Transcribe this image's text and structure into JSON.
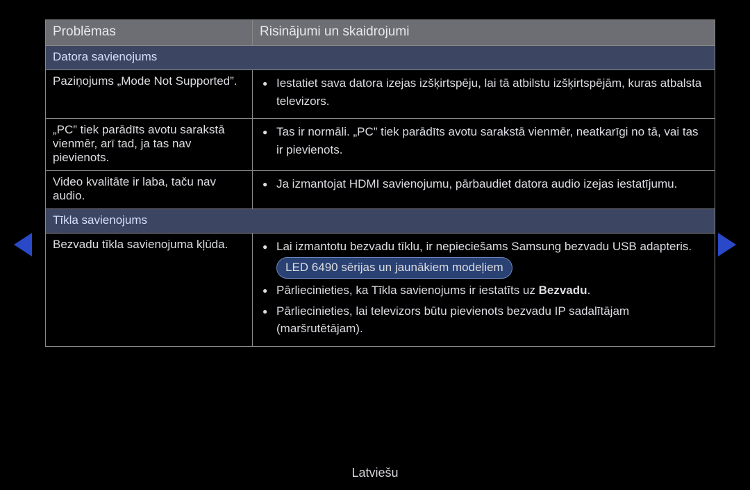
{
  "header": {
    "problems": "Problēmas",
    "solutions": "Risinājumi un skaidrojumi"
  },
  "sections": {
    "pc": "Datora savienojums",
    "net": "Tīkla savienojums"
  },
  "rows": {
    "r1": {
      "p": "Paziņojums „Mode Not Supported”.",
      "s1": "Iestatiet sava datora izejas izšķirtspēju, lai tā atbilstu izšķirtspējām, kuras atbalsta televizors."
    },
    "r2": {
      "p": "„PC” tiek parādīts avotu sarakstā vienmēr, arī tad, ja tas nav pievienots.",
      "s1": "Tas ir normāli. „PC” tiek parādīts avotu sarakstā vienmēr, neatkarīgi no tā, vai tas ir pievienots."
    },
    "r3": {
      "p": "Video kvalitāte ir laba, taču nav audio.",
      "s1": "Ja izmantojat HDMI savienojumu, pārbaudiet datora audio izejas iestatījumu."
    },
    "r4": {
      "p": "Bezvadu tīkla savienojuma kļūda.",
      "s1": "Lai izmantotu bezvadu tīklu, ir nepieciešams Samsung bezvadu USB adapteris.",
      "badge": "LED 6490 sērijas un jaunākiem modeļiem",
      "s2a": "Pārliecinieties, ka Tīkla savienojums ir iestatīts uz ",
      "s2b": "Bezvadu",
      "s2c": ".",
      "s3": "Pārliecinieties, lai televizors būtu pievienots bezvadu IP sadalītājam (maršrutētājam)."
    }
  },
  "language": "Latviešu"
}
